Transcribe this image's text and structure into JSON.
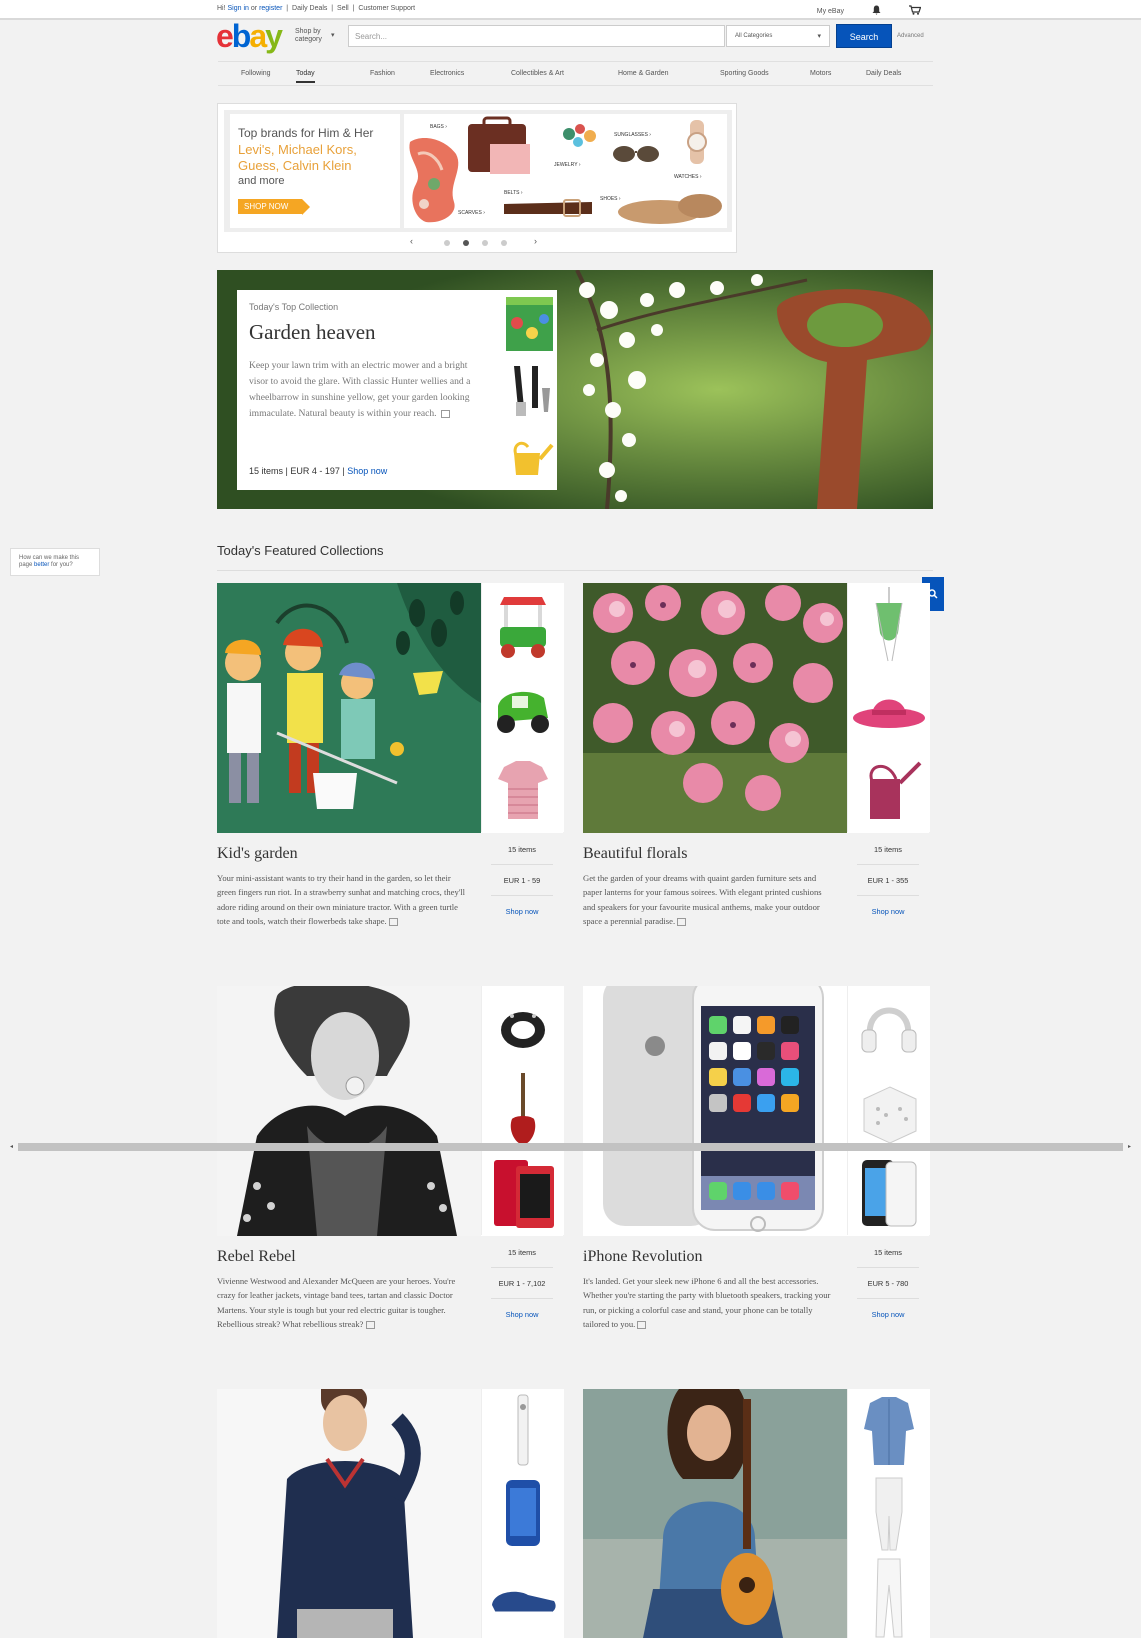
{
  "topbar": {
    "greeting": "Hi!",
    "sign_in": "Sign in",
    "or": "or",
    "register": "register",
    "daily_deals": "Daily Deals",
    "sell": "Sell",
    "support": "Customer Support",
    "my_ebay": "My eBay",
    "bell_icon": "bell-icon",
    "cart_icon": "cart-icon"
  },
  "header": {
    "logo": {
      "e": "e",
      "b": "b",
      "a": "a",
      "y": "y"
    },
    "shop_by": "Shop by",
    "category": "category",
    "search_placeholder": "Search...",
    "category_select": "All Categories",
    "search_button": "Search",
    "advanced": "Advanced"
  },
  "nav": {
    "items": [
      "Following",
      "Today",
      "Fashion",
      "Electronics",
      "Collectibles & Art",
      "Home & Garden",
      "Sporting Goods",
      "Motors",
      "Daily Deals"
    ],
    "active_index": 1
  },
  "promo": {
    "headline": "Top brands for Him & Her",
    "brands": "Levi's, Michael Kors, Guess, Calvin Klein",
    "more": "and more",
    "cta": "SHOP NOW",
    "labels": [
      "BAGS ›",
      "SUNGLASSES ›",
      "JEWELRY ›",
      "WATCHES ›",
      "BELTS ›",
      "SHOES ›",
      "SCARVES ›"
    ],
    "prev": "‹",
    "next": "›",
    "slide_count": 4,
    "active_slide": 2
  },
  "hero": {
    "kicker": "Today's Top Collection",
    "title": "Garden heaven",
    "body": "Keep your lawn trim with an electric mower and a bright visor to avoid the glare. With classic Hunter wellies and a wheelbarrow in sunshine yellow, get your garden looking immaculate. Natural beauty is within your reach.",
    "items": "15 items",
    "price": "EUR 4 - 197",
    "shop": "Shop now"
  },
  "feedback": {
    "line1": "How can we make this",
    "page": "page",
    "better": "better",
    "for_you": "for you?"
  },
  "featured": {
    "title": "Today's Featured Collections",
    "cards": [
      {
        "name": "Kid's garden",
        "desc": "Your mini-assistant wants to try their hand in the garden, so let their green fingers run riot. In a strawberry sunhat and matching crocs, they'll adore riding around on their own miniature tractor. With a green turtle tote and tools, watch their flowerbeds take shape.",
        "items": "15 items",
        "price": "EUR 1 - 59",
        "shop": "Shop now"
      },
      {
        "name": "Beautiful florals",
        "desc": "Get the garden of your dreams with quaint garden furniture sets and paper lanterns for your famous soirees. With elegant printed cushions and speakers for your favourite musical anthems, make your outdoor space a perennial paradise.",
        "items": "15 items",
        "price": "EUR 1 - 355",
        "shop": "Shop now"
      },
      {
        "name": "Rebel Rebel",
        "desc": "Vivienne Westwood and Alexander McQueen are your heroes. You're crazy for leather jackets, vintage band tees, tartan and classic Doctor Martens. Your style is tough but your red electric guitar is tougher. Rebellious streak? What rebellious streak?",
        "items": "15 items",
        "price": "EUR 1 - 7,102",
        "shop": "Shop now"
      },
      {
        "name": "iPhone Revolution",
        "desc": "It's landed. Get your sleek new iPhone 6 and all the best accessories. Whether you're starting the party with bluetooth speakers, tracking your run, or picking a colorful case and stand, your phone can be totally tailored to you.",
        "items": "15 items",
        "price": "EUR 5 - 780",
        "shop": "Shop now"
      }
    ]
  },
  "colors": {
    "accent": "#0654ba",
    "promo_orange": "#f5a623",
    "brand_orange": "#e8a13a"
  }
}
